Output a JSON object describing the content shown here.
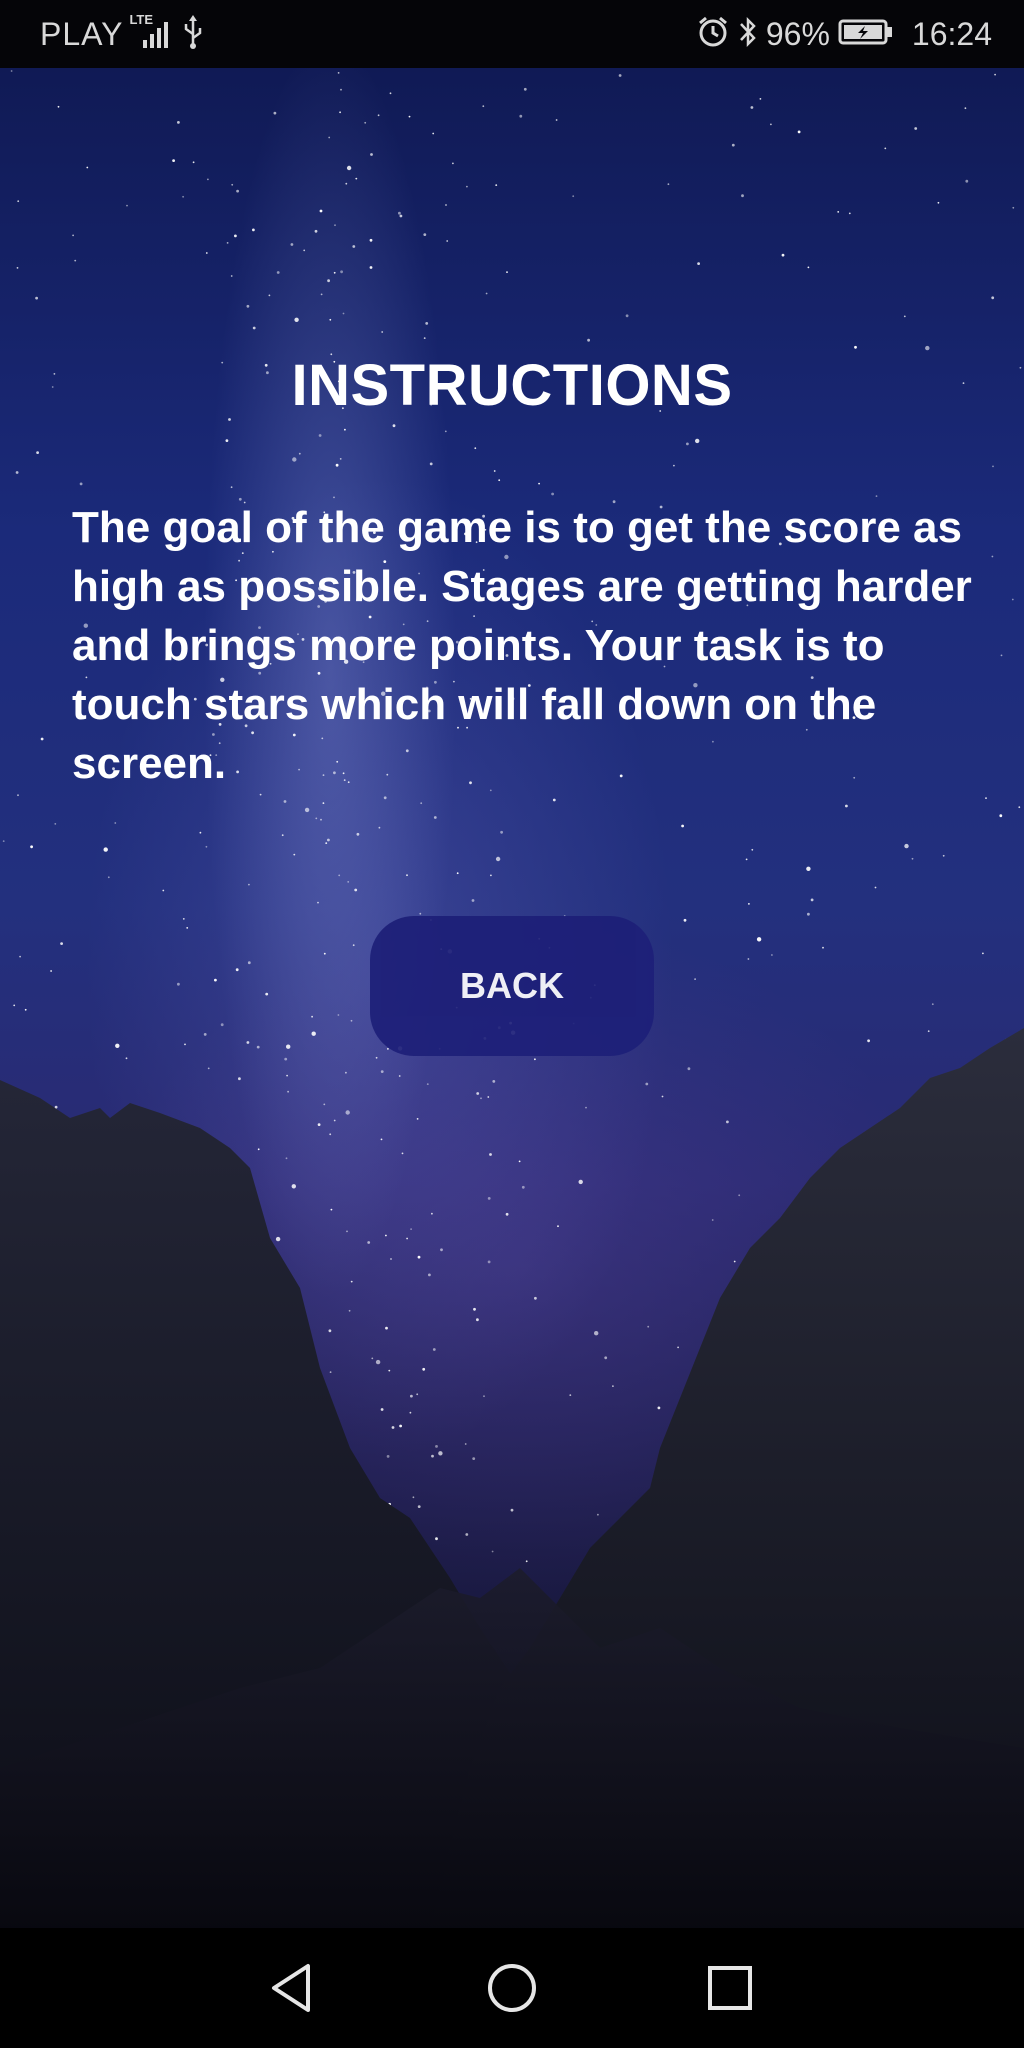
{
  "status_bar": {
    "carrier": "PLAY",
    "network": "LTE",
    "battery_percent": "96%",
    "time": "16:24"
  },
  "content": {
    "title": "INSTRUCTIONS",
    "description": "The goal of the game is to get the score as high as possible. Stages are getting harder and brings more points. Your task is to touch stars which will fall down on the screen.",
    "back_button": "BACK"
  },
  "nav_bar": {
    "icons": [
      "back-triangle-icon",
      "home-circle-icon",
      "recents-square-icon"
    ]
  },
  "colors": {
    "button": "#1d1f78",
    "sky_top": "#101a55",
    "sky_mid": "#2a2a72",
    "text": "#ffffff"
  }
}
